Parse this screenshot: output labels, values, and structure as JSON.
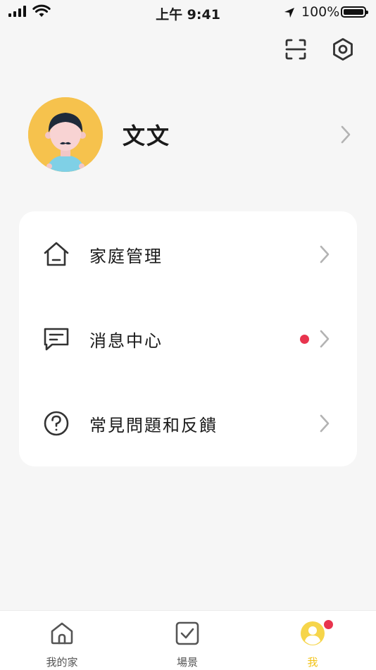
{
  "status_bar": {
    "time": "上午 9:41",
    "battery": "100%"
  },
  "top_actions": {
    "scan_icon": "scan-icon",
    "settings_icon": "hexagon-settings-icon"
  },
  "profile": {
    "name": "文文",
    "avatar_bg": "#f6c24d"
  },
  "menu": {
    "items": [
      {
        "label": "家庭管理",
        "icon": "home-icon",
        "badge": false
      },
      {
        "label": "消息中心",
        "icon": "message-icon",
        "badge": true
      },
      {
        "label": "常見問題和反饋",
        "icon": "help-icon",
        "badge": false
      }
    ]
  },
  "tab_bar": {
    "items": [
      {
        "label": "我的家",
        "icon": "home-tab-icon",
        "active": false
      },
      {
        "label": "場景",
        "icon": "scene-check-icon",
        "active": false
      },
      {
        "label": "我",
        "icon": "profile-tab-icon",
        "active": true,
        "badge": true
      }
    ]
  },
  "colors": {
    "accent": "#f2c318",
    "badge": "#e8344e",
    "background": "#f6f6f6",
    "card": "#ffffff"
  }
}
